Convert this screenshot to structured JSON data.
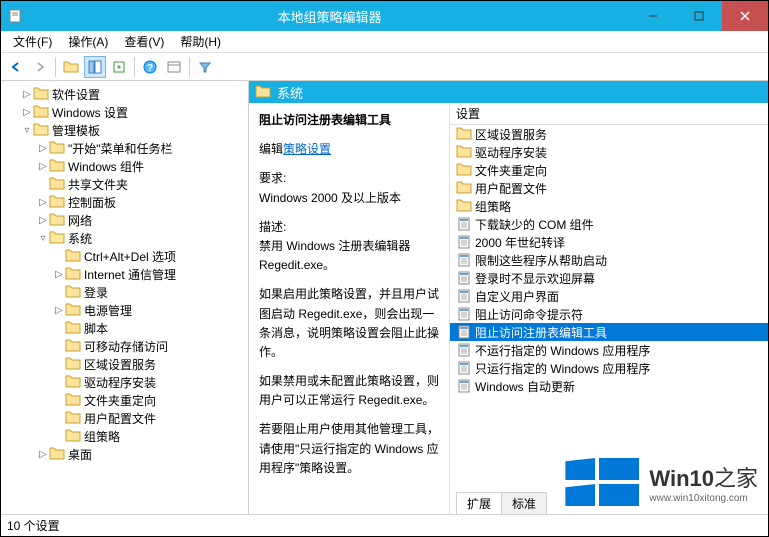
{
  "window": {
    "title": "本地组策略编辑器"
  },
  "menu": {
    "file": "文件(F)",
    "action": "操作(A)",
    "view": "查看(V)",
    "help": "帮助(H)"
  },
  "tree": {
    "root1": "软件设置",
    "root2": "Windows 设置",
    "root3": "管理模板",
    "n1": "\"开始\"菜单和任务栏",
    "n2": "Windows 组件",
    "n3": "共享文件夹",
    "n4": "控制面板",
    "n5": "网络",
    "n6": "系统",
    "n6a": "Ctrl+Alt+Del 选项",
    "n6b": "Internet 通信管理",
    "n6c": "登录",
    "n6d": "电源管理",
    "n6e": "脚本",
    "n6f": "可移动存储访问",
    "n6g": "区域设置服务",
    "n6h": "驱动程序安装",
    "n6i": "文件夹重定向",
    "n6j": "用户配置文件",
    "n6k": "组策略",
    "root4": "桌面"
  },
  "content": {
    "header": "系统",
    "selected_name": "阻止访问注册表编辑工具",
    "edit_label": "编辑",
    "edit_link": "策略设置",
    "req_label": "要求:",
    "req_text": "Windows 2000 及以上版本",
    "desc_label": "描述:",
    "desc_p1": "禁用 Windows 注册表编辑器 Regedit.exe。",
    "desc_p2": "如果启用此策略设置，并且用户试图启动 Regedit.exe，则会出现一条消息，说明策略设置会阻止此操作。",
    "desc_p3": "如果禁用或未配置此策略设置，则用户可以正常运行 Regedit.exe。",
    "desc_p4": "若要阻止用户使用其他管理工具，请使用\"只运行指定的 Windows 应用程序\"策略设置。"
  },
  "list": {
    "header": "设置",
    "items": [
      {
        "label": "区域设置服务",
        "type": "folder"
      },
      {
        "label": "驱动程序安装",
        "type": "folder"
      },
      {
        "label": "文件夹重定向",
        "type": "folder"
      },
      {
        "label": "用户配置文件",
        "type": "folder"
      },
      {
        "label": "组策略",
        "type": "folder"
      },
      {
        "label": "下载缺少的 COM 组件",
        "type": "setting"
      },
      {
        "label": "2000 年世纪转译",
        "type": "setting"
      },
      {
        "label": "限制这些程序从帮助启动",
        "type": "setting"
      },
      {
        "label": "登录时不显示欢迎屏幕",
        "type": "setting"
      },
      {
        "label": "自定义用户界面",
        "type": "setting"
      },
      {
        "label": "阻止访问命令提示符",
        "type": "setting"
      },
      {
        "label": "阻止访问注册表编辑工具",
        "type": "setting",
        "selected": true
      },
      {
        "label": "不运行指定的 Windows 应用程序",
        "type": "setting"
      },
      {
        "label": "只运行指定的 Windows 应用程序",
        "type": "setting"
      },
      {
        "label": "Windows 自动更新",
        "type": "setting"
      }
    ]
  },
  "tabs": {
    "extended": "扩展",
    "standard": "标准"
  },
  "statusbar": "10 个设置",
  "watermark": {
    "brand": "Win10",
    "suffix": "之家",
    "url": "www.win10xitong.com"
  }
}
